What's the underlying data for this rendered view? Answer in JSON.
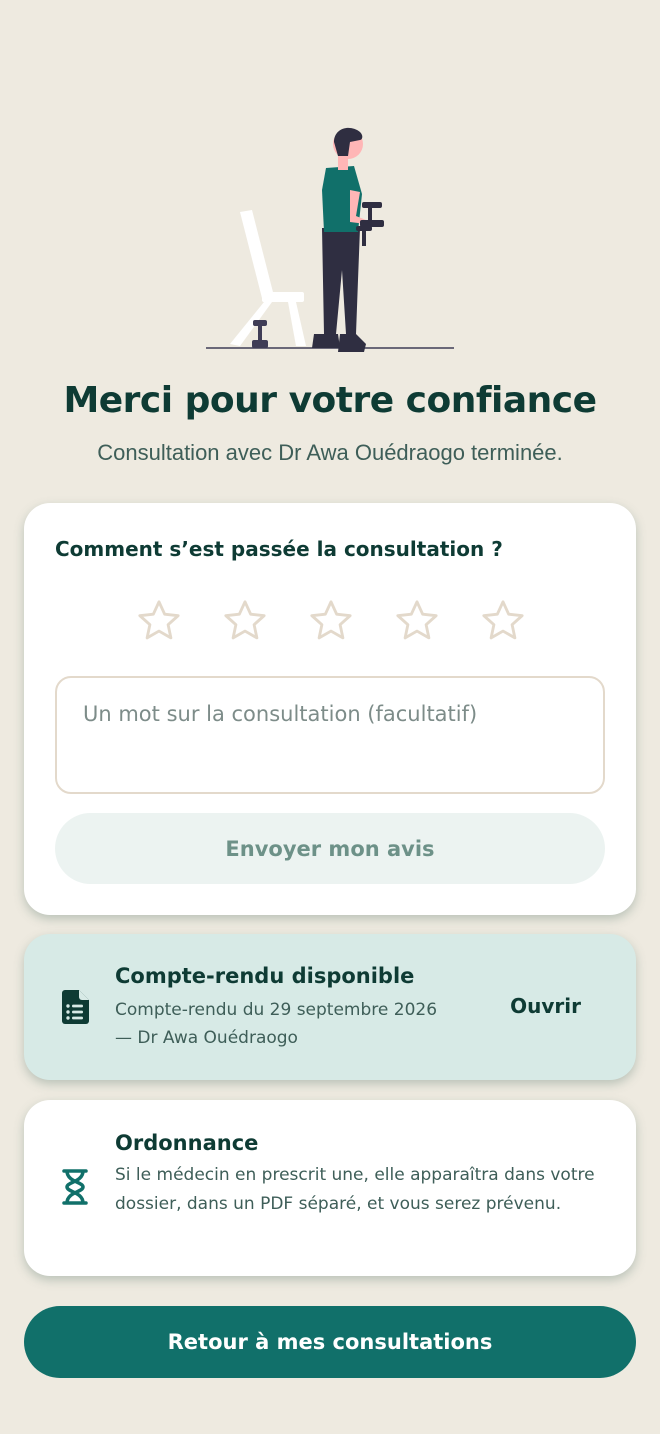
{
  "header": {
    "title": "Merci pour votre confiance",
    "subtitle": "Consultation avec Dr Awa Ouédraogo terminée."
  },
  "rating": {
    "question": "Comment s’est passée la consultation ?",
    "max_stars": 5,
    "selected_stars": 0,
    "star_outline_color": "#E3D9CB",
    "comment_placeholder": "Un mot sur la consultation (facultatif)",
    "comment_value": "",
    "submit_label": "Envoyer mon avis"
  },
  "report": {
    "title": "Compte-rendu disponible",
    "description_line1": "Compte-rendu du 29 septembre 2026",
    "description_line2": "— Dr Awa Ouédraogo",
    "open_label": "Ouvrir",
    "icon": "document-icon"
  },
  "prescription": {
    "title": "Ordonnance",
    "description": "Si le médecin en prescrit une, elle apparaîtra dans votre dossier, dans un PDF séparé, et vous serez prévenu.",
    "icon": "hourglass-icon"
  },
  "footer": {
    "back_label": "Retour à mes consultations"
  },
  "colors": {
    "background": "#EEEAE0",
    "primary": "#11706A",
    "text_dark": "#0E3B34",
    "report_bg": "#D7EAE6"
  }
}
